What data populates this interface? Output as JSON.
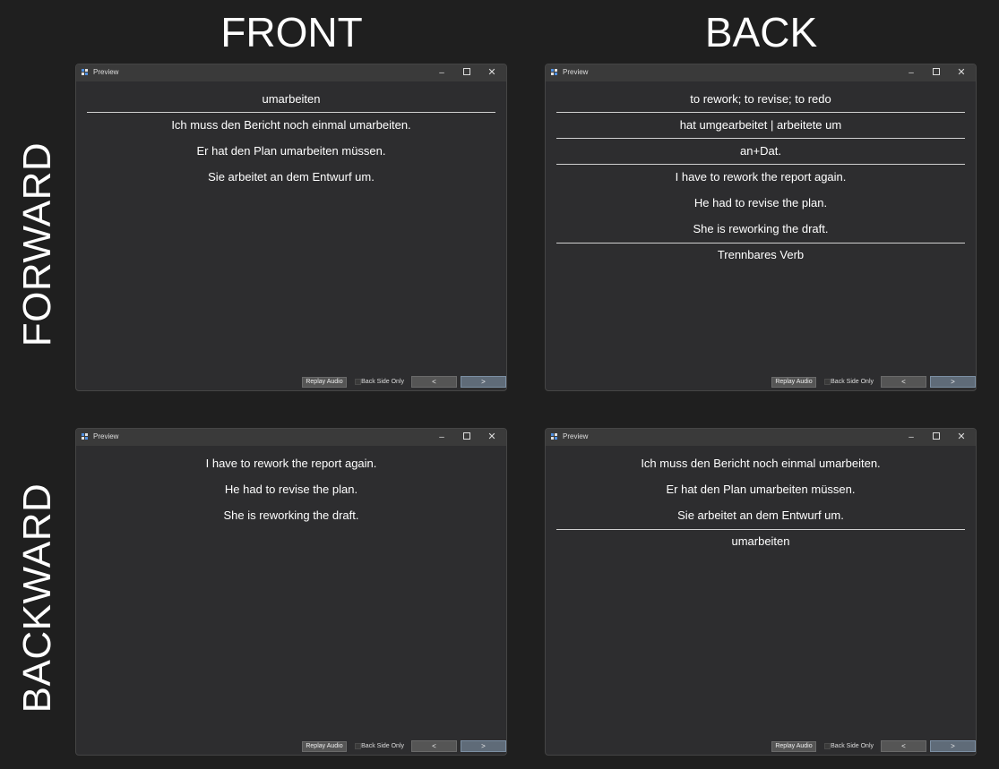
{
  "headings": {
    "front": "FRONT",
    "back": "BACK",
    "forward": "FORWARD",
    "backward": "BACKWARD"
  },
  "window": {
    "title": "Preview",
    "minimize_glyph": "–",
    "close_glyph": "✕",
    "replay_audio": "Replay Audio",
    "back_side_only": "Back Side Only",
    "back_side_only_checked": false,
    "prev": "<",
    "next": ">"
  },
  "cards": {
    "forward_front": {
      "term": "umarbeiten",
      "examples": [
        "Ich muss den Bericht noch einmal umarbeiten.",
        "Er hat den Plan umarbeiten müssen.",
        "Sie arbeitet an dem Entwurf um."
      ]
    },
    "forward_back": {
      "translation": "to rework; to revise; to redo",
      "forms": "hat umgearbeitet | arbeitete um",
      "preposition": "an+Dat.",
      "examples": [
        "I have to rework the report again.",
        "He had to revise the plan.",
        "She is reworking the draft."
      ],
      "note": "Trennbares Verb"
    },
    "backward_front": {
      "examples": [
        "I have to rework the report again.",
        "He had to revise the plan.",
        "She is reworking the draft."
      ]
    },
    "backward_back": {
      "examples": [
        "Ich muss den Bericht noch einmal umarbeiten.",
        "Er hat den Plan umarbeiten müssen.",
        "Sie arbeitet an dem Entwurf um."
      ],
      "term": "umarbeiten"
    }
  }
}
